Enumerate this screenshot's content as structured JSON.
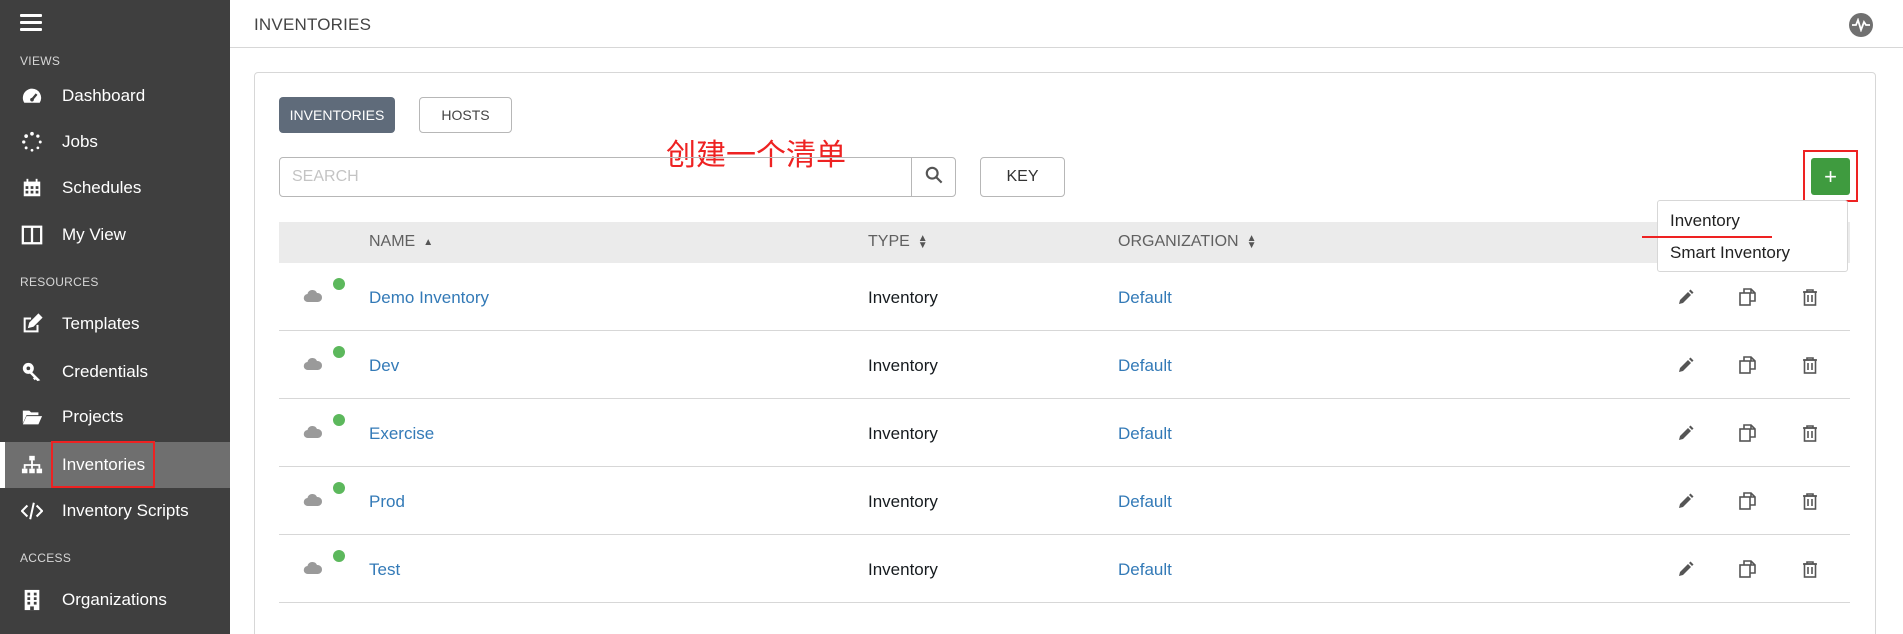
{
  "sidebar": {
    "sections": {
      "views": "VIEWS",
      "resources": "RESOURCES",
      "access": "ACCESS"
    },
    "items": [
      {
        "label": "Dashboard",
        "icon": "dashboard-icon"
      },
      {
        "label": "Jobs",
        "icon": "spinner-icon"
      },
      {
        "label": "Schedules",
        "icon": "calendar-icon"
      },
      {
        "label": "My View",
        "icon": "columns-icon"
      },
      {
        "label": "Templates",
        "icon": "edit-icon"
      },
      {
        "label": "Credentials",
        "icon": "key-icon"
      },
      {
        "label": "Projects",
        "icon": "folder-open-icon"
      },
      {
        "label": "Inventories",
        "icon": "sitemap-icon",
        "active": true
      },
      {
        "label": "Inventory Scripts",
        "icon": "code-icon"
      },
      {
        "label": "Organizations",
        "icon": "building-icon"
      }
    ]
  },
  "header": {
    "title": "INVENTORIES"
  },
  "tabs": {
    "inventories": "INVENTORIES",
    "hosts": "HOSTS"
  },
  "annotation": "创建一个清单",
  "search": {
    "placeholder": "SEARCH",
    "key_label": "KEY"
  },
  "add_button": "+",
  "dropdown": {
    "options": [
      "Inventory",
      "Smart Inventory"
    ]
  },
  "table": {
    "columns": {
      "name": "NAME",
      "type": "TYPE",
      "organization": "ORGANIZATION"
    },
    "rows": [
      {
        "name": "Demo Inventory",
        "type": "Inventory",
        "organization": "Default"
      },
      {
        "name": "Dev",
        "type": "Inventory",
        "organization": "Default"
      },
      {
        "name": "Exercise",
        "type": "Inventory",
        "organization": "Default"
      },
      {
        "name": "Prod",
        "type": "Inventory",
        "organization": "Default"
      },
      {
        "name": "Test",
        "type": "Inventory",
        "organization": "Default"
      }
    ]
  },
  "colors": {
    "sidebar": "#3f3f3f",
    "active_item": "#6f6f6f",
    "link": "#337ab7",
    "add_button": "#3f9b3f",
    "status_ok": "#5cb85c",
    "annotation": "#e22222"
  }
}
